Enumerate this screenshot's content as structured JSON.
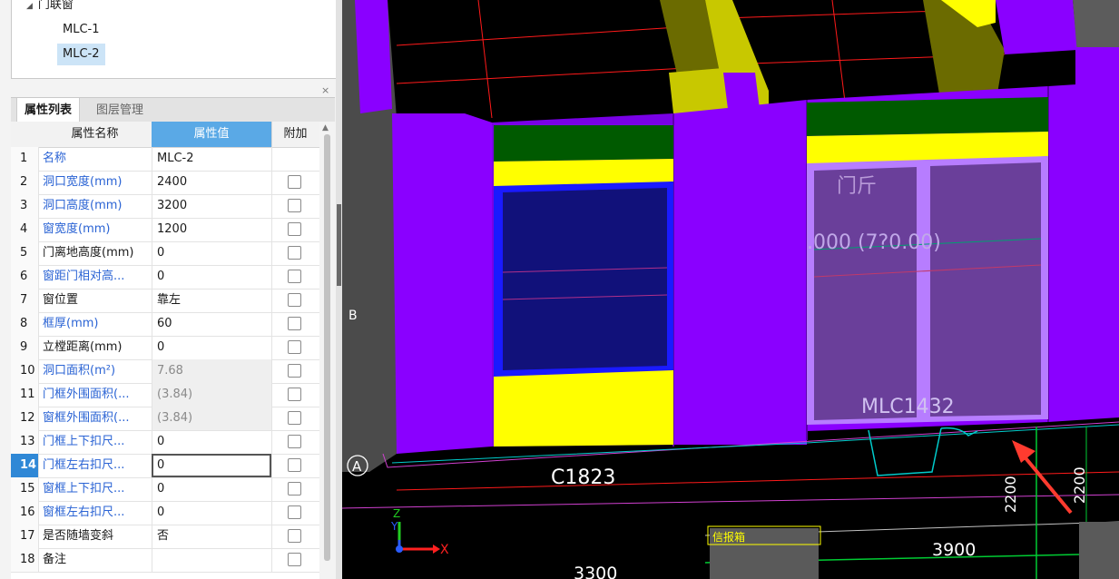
{
  "tree": {
    "parent": "门联窗",
    "children": [
      "MLC-1",
      "MLC-2"
    ]
  },
  "panel": {
    "close": "×",
    "tabs": [
      "属性列表",
      "图层管理"
    ]
  },
  "grid": {
    "headers": {
      "name": "属性名称",
      "value": "属性值",
      "attach": "附加"
    },
    "rows": [
      {
        "num": "1",
        "name": "名称",
        "value": "MLC-2",
        "style": "blue",
        "vstyle": "",
        "attach": false
      },
      {
        "num": "2",
        "name": "洞口宽度(mm)",
        "value": "2400",
        "style": "blue",
        "vstyle": "",
        "attach": true
      },
      {
        "num": "3",
        "name": "洞口高度(mm)",
        "value": "3200",
        "style": "blue",
        "vstyle": "",
        "attach": true
      },
      {
        "num": "4",
        "name": "窗宽度(mm)",
        "value": "1200",
        "style": "blue",
        "vstyle": "",
        "attach": true
      },
      {
        "num": "5",
        "name": "门离地高度(mm)",
        "value": "0",
        "style": "",
        "vstyle": "",
        "attach": true
      },
      {
        "num": "6",
        "name": "窗距门相对高...",
        "value": "0",
        "style": "blue",
        "vstyle": "",
        "attach": true
      },
      {
        "num": "7",
        "name": "窗位置",
        "value": "靠左",
        "style": "",
        "vstyle": "",
        "attach": true
      },
      {
        "num": "8",
        "name": "框厚(mm)",
        "value": "60",
        "style": "blue",
        "vstyle": "",
        "attach": true
      },
      {
        "num": "9",
        "name": "立樘距离(mm)",
        "value": "0",
        "style": "",
        "vstyle": "",
        "attach": true
      },
      {
        "num": "10",
        "name": "洞口面积(m²)",
        "value": "7.68",
        "style": "blue",
        "vstyle": "ro",
        "attach": true
      },
      {
        "num": "11",
        "name": "门框外围面积(...",
        "value": "(3.84)",
        "style": "blue",
        "vstyle": "ro",
        "attach": true
      },
      {
        "num": "12",
        "name": "窗框外围面积(...",
        "value": "(3.84)",
        "style": "blue",
        "vstyle": "ro",
        "attach": true
      },
      {
        "num": "13",
        "name": "门框上下扣尺...",
        "value": "0",
        "style": "blue",
        "vstyle": "",
        "attach": true
      },
      {
        "num": "14",
        "name": "门框左右扣尺...",
        "value": "0",
        "style": "blue",
        "vstyle": "",
        "attach": true,
        "selected": true
      },
      {
        "num": "15",
        "name": "窗框上下扣尺...",
        "value": "0",
        "style": "blue",
        "vstyle": "",
        "attach": true
      },
      {
        "num": "16",
        "name": "窗框左右扣尺...",
        "value": "0",
        "style": "blue",
        "vstyle": "",
        "attach": true
      },
      {
        "num": "17",
        "name": "是否随墙变斜",
        "value": "否",
        "style": "",
        "vstyle": "",
        "attach": true
      },
      {
        "num": "18",
        "name": "备注",
        "value": "",
        "style": "",
        "vstyle": "",
        "attach": true
      }
    ]
  },
  "viewport": {
    "axis_a": "A",
    "axis_b": "B",
    "window_label": "C1823",
    "door_label": "MLC1432",
    "door_text_1": "门斤",
    "door_text_2": ".000 (7?0.00)",
    "dim_2200_a": "2200",
    "dim_2200_b": "2200",
    "dim_3900": "3900",
    "dim_3300": "3300",
    "box_label": "信报箱",
    "ucs_y": "Y",
    "ucs_z": "Z",
    "ucs_x": "X",
    "colors": {
      "wall": "#8a00ff",
      "yellow": "#ffff00",
      "green": "#005a00",
      "glass": "#11117a",
      "door": "#6a3f9a",
      "arrow": "#ff3b2f"
    }
  }
}
